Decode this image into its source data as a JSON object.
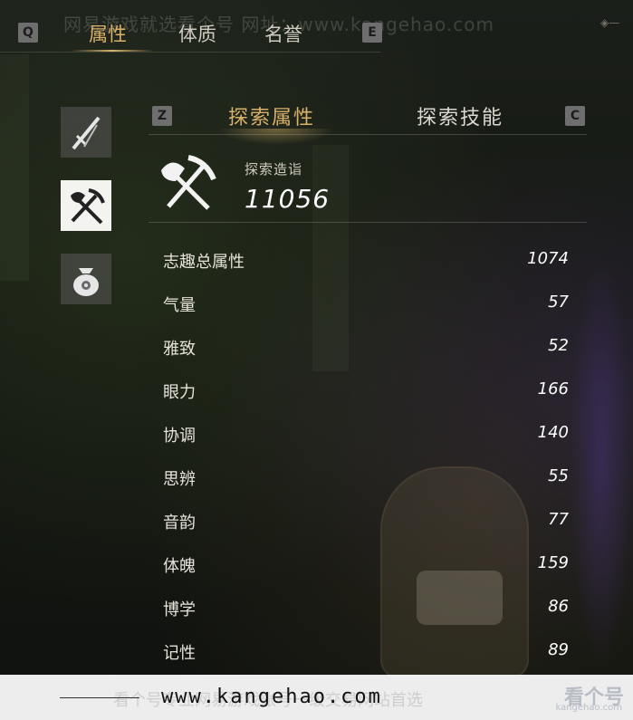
{
  "watermark_top": "网易游戏就选看个号  网址：www.kangehao.com",
  "top_tabs": {
    "key_prev": "Q",
    "key_next": "E",
    "items": [
      {
        "label": "属性",
        "active": true
      },
      {
        "label": "体质",
        "active": false
      },
      {
        "label": "名誉",
        "active": false
      }
    ]
  },
  "categories": [
    {
      "icon": "sword-icon",
      "active": false
    },
    {
      "icon": "shovel-pickaxe-icon",
      "active": true
    },
    {
      "icon": "money-bag-icon",
      "active": false
    }
  ],
  "sub_tabs": {
    "key_prev": "Z",
    "key_next": "C",
    "items": [
      {
        "label": "探索属性",
        "active": true
      },
      {
        "label": "探索技能",
        "active": false
      }
    ]
  },
  "exploration": {
    "label": "探索造诣",
    "value": "11056"
  },
  "stats": [
    {
      "name": "志趣总属性",
      "value": "1074"
    },
    {
      "name": "气量",
      "value": "57"
    },
    {
      "name": "雅致",
      "value": "52"
    },
    {
      "name": "眼力",
      "value": "166"
    },
    {
      "name": "协调",
      "value": "140"
    },
    {
      "name": "思辨",
      "value": "55"
    },
    {
      "name": "音韵",
      "value": "77"
    },
    {
      "name": "体魄",
      "value": "159"
    },
    {
      "name": "博学",
      "value": "86"
    },
    {
      "name": "记性",
      "value": "89"
    }
  ],
  "footer": {
    "url": "www.kangehao.com",
    "watermark": "看个号专业网易游戏账号一级交易网站首选",
    "logo_text": "看个号",
    "logo_sub": "kangehao.com"
  },
  "colors": {
    "accent_gold": "#d9b16a",
    "active_icon_bg": "#f3f3f0"
  }
}
